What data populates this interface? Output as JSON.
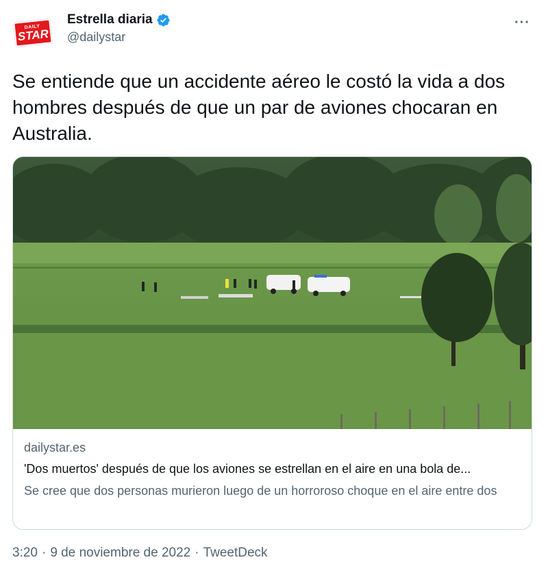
{
  "account": {
    "display_name": "Estrella diaria",
    "handle": "@dailystar",
    "logo_small": "DAILY",
    "logo_big": "STAR",
    "verified_color": "#1d9bf0"
  },
  "tweet": {
    "text": "Se entiende que un accidente aéreo le costó la vida a dos hombres después de que un par de aviones chocaran en Australia."
  },
  "card": {
    "domain": "dailystar.es",
    "title": "'Dos muertos' después de que los aviones se estrellan en el aire en una bola de...",
    "description": "Se cree que dos personas murieron luego de un horroroso choque en el aire entre dos"
  },
  "meta": {
    "time": "3:20",
    "sep1": "·",
    "date": "9 de noviembre de 2022",
    "sep2": "·",
    "source": "TweetDeck"
  },
  "icons": {
    "more": "more-options-icon",
    "verified": "verified-badge-icon"
  }
}
